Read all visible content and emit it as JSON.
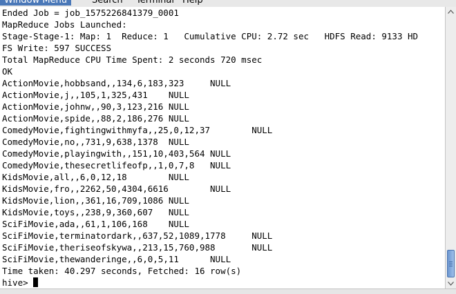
{
  "menubar": {
    "items": [
      "Window Menu",
      "Search",
      "Terminal",
      "Help"
    ]
  },
  "terminal": {
    "lines": [
      "Ended Job = job_1575226841379_0001",
      "MapReduce Jobs Launched:",
      "Stage-Stage-1: Map: 1  Reduce: 1   Cumulative CPU: 2.72 sec   HDFS Read: 9133 HD",
      "FS Write: 597 SUCCESS",
      "Total MapReduce CPU Time Spent: 2 seconds 720 msec",
      "OK",
      "ActionMovie,hobbsand,,134,6,183,323     NULL",
      "ActionMovie,j,,105,1,325,431    NULL",
      "ActionMovie,johnw,,90,3,123,216 NULL",
      "ActionMovie,spide,,88,2,186,276 NULL",
      "ComedyMovie,fightingwithmyfa,,25,0,12,37        NULL",
      "ComedyMovie,no,,731,9,638,1378  NULL",
      "ComedyMovie,playingwith,,151,10,403,564 NULL",
      "ComedyMovie,thesecretlifeofp,,1,0,7,8   NULL",
      "KidsMovie,all,,6,0,12,18        NULL",
      "KidsMovie,fro,,2262,50,4304,6616        NULL",
      "KidsMovie,lion,,361,16,709,1086 NULL",
      "KidsMovie,toys,,238,9,360,607   NULL",
      "SciFiMovie,ada,,61,1,106,168    NULL",
      "SciFiMovie,terminatordark,,637,52,1089,1778     NULL",
      "SciFiMovie,theriseofskywa,,213,15,760,988       NULL",
      "SciFiMovie,thewanderinge,,6,0,5,11      NULL",
      "Time taken: 40.297 seconds, Fetched: 16 row(s)"
    ],
    "prompt": "hive> "
  },
  "colors": {
    "terminal_bg": "#ffffff",
    "text": "#000000",
    "scroll_thumb": "#6b96d0",
    "menu_selected": "#4a78b8"
  }
}
